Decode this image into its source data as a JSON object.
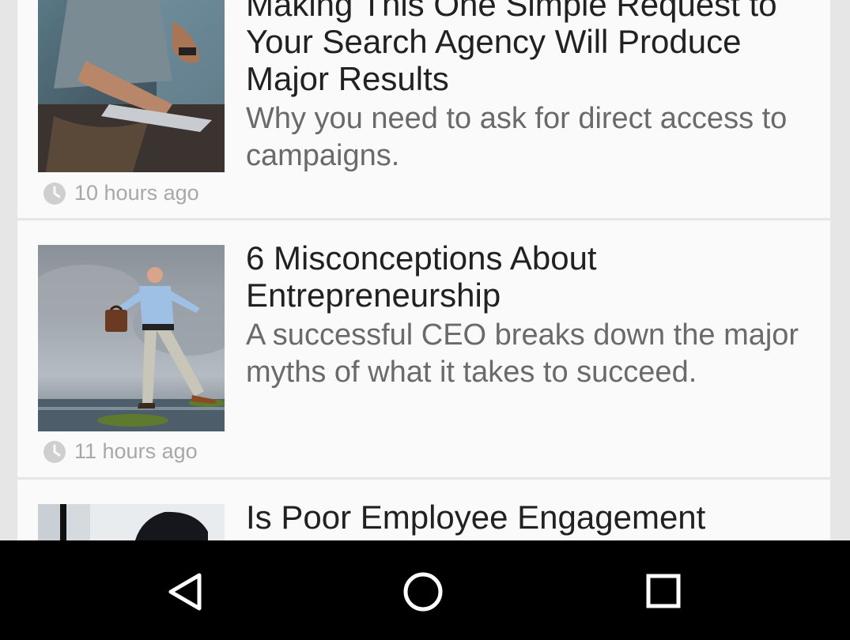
{
  "articles": [
    {
      "title": "Making This One Simple Request to Your Search Agency Will Produce Major Results",
      "subtitle": "Why you need to ask for direct access to campaigns.",
      "time": "10 hours ago",
      "image": "man-with-laptop-photo"
    },
    {
      "title": "6 Misconceptions About Entrepreneurship",
      "subtitle": "A successful CEO breaks down the major myths of what it takes to succeed.",
      "time": "11 hours ago",
      "image": "businessman-walking-on-islands-photo"
    },
    {
      "title": "Is Poor Employee Engagement",
      "image": "dark-office-photo"
    }
  ],
  "navbar": {
    "back_icon": "back-triangle-icon",
    "home_icon": "home-circle-icon",
    "recents_icon": "recents-square-icon"
  }
}
